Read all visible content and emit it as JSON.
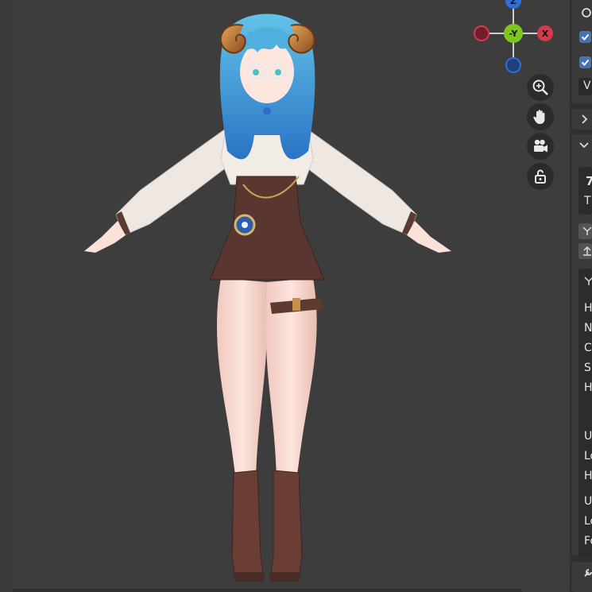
{
  "viewport": {
    "gizmo": {
      "z_label": "Z",
      "y_label": "-Y",
      "x_label": "X",
      "colors": {
        "z": "#2f6fd6",
        "y": "#7dc61e",
        "x": "#d43a4b"
      }
    },
    "nav_buttons": [
      "zoom-icon",
      "hand-pan-icon",
      "camera-icon",
      "unlock-icon"
    ]
  },
  "side_panel": {
    "top_letters": [
      "V"
    ],
    "section_letters": [
      "T"
    ],
    "list_letters": [
      "H",
      "N",
      "C",
      "S",
      "H",
      "U",
      "Lo",
      "H",
      "U",
      "Lo",
      "Fo"
    ],
    "accent_color": "#4772b3"
  }
}
